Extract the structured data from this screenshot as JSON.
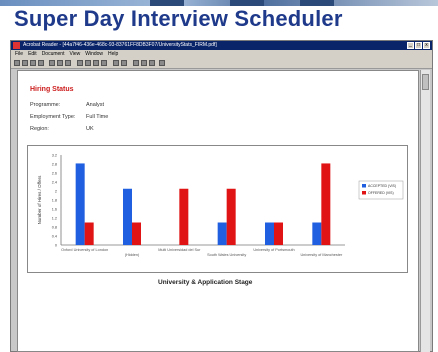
{
  "slide": {
    "title": "Super Day Interview Scheduler"
  },
  "window": {
    "title": "Acrobat Reader - [44a7f46-436e-468c-93-83761FF8DB3F07/UniversityStats_FIRM.pdf]",
    "menus": [
      "File",
      "Edit",
      "Document",
      "View",
      "Window",
      "Help"
    ],
    "controls": [
      "_",
      "□",
      "x"
    ]
  },
  "report": {
    "heading": "Hiring Status",
    "fields": [
      {
        "label": "Programme:",
        "value": "Analyst"
      },
      {
        "label": "Employment Type:",
        "value": "Full Time"
      },
      {
        "label": "Region:",
        "value": "UK"
      }
    ]
  },
  "colors": {
    "series_blue": "#1f5fe0",
    "series_red": "#e01414",
    "heading_red": "#cc1b1b",
    "title_blue": "#1f3a8a"
  },
  "chart_data": {
    "type": "bar",
    "title": "",
    "xlabel": "University & Application Stage",
    "ylabel": "Number of Hires / Offers",
    "ylim": [
      0,
      3.2
    ],
    "yticks": [
      "3.2",
      "2.8",
      "2.6",
      "2.4",
      "2",
      "1.8",
      "1.6",
      "1.2",
      "0.8",
      "0.4",
      "0"
    ],
    "categories": [
      "Oxford University of London",
      "(Hidden)",
      "Multi Universidad del Sur",
      "South Wales University",
      "University of Portsmouth",
      "University of Manchester"
    ],
    "series": [
      {
        "name": "ACCEPTED (VIS)",
        "values": [
          2.9,
          2.0,
          0,
          0.8,
          0.8,
          0.8
        ]
      },
      {
        "name": "OFFERED (VIS)",
        "values": [
          0.8,
          0.8,
          2.0,
          2.0,
          0.8,
          2.9
        ]
      }
    ],
    "legend": "right",
    "grid": false
  }
}
